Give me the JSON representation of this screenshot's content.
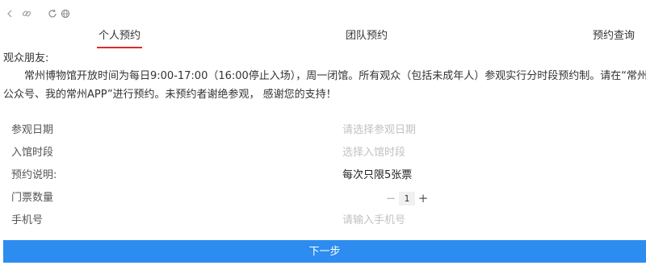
{
  "toolbar": {
    "icons": [
      "back-icon",
      "link-icon",
      "refresh-icon",
      "globe-icon"
    ]
  },
  "tabs": {
    "personal": "个人预约",
    "team": "团队预约",
    "query": "预约查询",
    "active_color": "#e02a2a"
  },
  "notice": {
    "greeting": "观众朋友:",
    "line1": "常州博物馆开放时间为每日9:00-17:00（16:00停止入场），周一闭馆。所有观众（包括未成年人）参观实行分时段预约制。请在“常州博物馆",
    "line2": "公众号、我的常州APP”进行预约。未预约者谢绝参观， 感谢您的支持！"
  },
  "form": {
    "date": {
      "label": "参观日期",
      "placeholder": "请选择参观日期"
    },
    "timeslot": {
      "label": "入馆时段",
      "placeholder": "选择入馆时段"
    },
    "note": {
      "label": "预约说明:",
      "value": "每次只限5张票"
    },
    "quantity": {
      "label": "门票数量",
      "minus": "−",
      "value": "1",
      "plus": "+"
    },
    "phone": {
      "label": "手机号",
      "placeholder": "请输入手机号"
    }
  },
  "actions": {
    "next_label": "下一步",
    "button_color": "#2d8cf0"
  }
}
